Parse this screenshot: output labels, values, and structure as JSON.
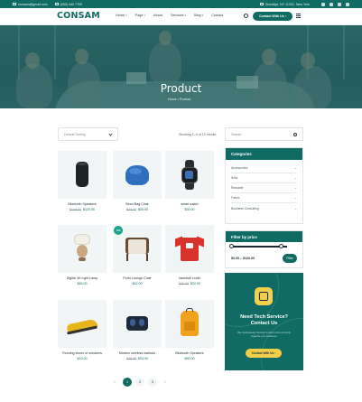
{
  "topbar": {
    "email": "consam@gmail.com",
    "phone": "(000) 440-7700",
    "address": "Brooklyn, NY 11201, New York"
  },
  "header": {
    "logo": "CONSAM",
    "nav": [
      {
        "label": "Home",
        "caret": true
      },
      {
        "label": "Page",
        "caret": true
      },
      {
        "label": "About",
        "caret": false
      },
      {
        "label": "Services",
        "caret": true
      },
      {
        "label": "Blog",
        "caret": true
      },
      {
        "label": "Contact",
        "caret": false
      }
    ],
    "cta": "Contact With Us",
    "cta_arrow": "›"
  },
  "hero": {
    "title": "Product",
    "breadcrumb": "Home  •  Product"
  },
  "toolbar": {
    "sort_placeholder": "Default Sorting",
    "showing": "Showing 1–9 of 12 results"
  },
  "products": [
    {
      "name": "Bluetooth Speakers",
      "old": "$149.00",
      "price": "$120.00",
      "icon": "speaker"
    },
    {
      "name": "Bean Bag Chair",
      "old": "$40.00",
      "price": "$35.00",
      "icon": "beanbag"
    },
    {
      "name": "smart watch",
      "old": "",
      "price": "$30.00",
      "icon": "watch"
    },
    {
      "name": "Digital Jet Light Lamp",
      "old": "",
      "price": "$45.00",
      "icon": "lamp"
    },
    {
      "name": "Porto Lounge Chair",
      "old": "",
      "price": "$42.00",
      "icon": "chair",
      "sale": "-5%"
    },
    {
      "name": "baseball t-shirt",
      "old": "$39.00",
      "price": "$32.00",
      "icon": "tshirt"
    },
    {
      "name": "Running shoes or sneakers",
      "old": "",
      "price": "$19.00",
      "icon": "shoes"
    },
    {
      "name": "Modern wireless earbuds",
      "old": "$38.00",
      "price": "$34.00",
      "icon": "earbuds"
    },
    {
      "name": "Bluetooth Speakers",
      "old": "",
      "price": "$50.00",
      "icon": "backpack"
    }
  ],
  "sidebar": {
    "search_placeholder": "Search",
    "categories_title": "Categories",
    "categories": [
      "Accessories",
      "Sofa",
      "Rentable",
      "Fabric",
      "Business Consulting"
    ],
    "category_arrow": "→",
    "filter_title": "Filter by price",
    "price_range": "$0.00 – $120.00",
    "price_min_fraction": 0.0,
    "price_max_fraction": 0.88,
    "filter_button": "Filter",
    "cta_title_1": "Need Tech Service?",
    "cta_title_2": "Contact Us",
    "cta_text": "We meticulously develop systems that correctly organize your business.",
    "cta_button": "Contact With Us  ›"
  },
  "pagination": {
    "prev": "‹",
    "pages": [
      "1",
      "2",
      "3"
    ],
    "active": "1",
    "next": "›"
  },
  "colors": {
    "brand": "#0f6b63",
    "accent": "#f2cf4a",
    "sale": "#1aa38c"
  }
}
